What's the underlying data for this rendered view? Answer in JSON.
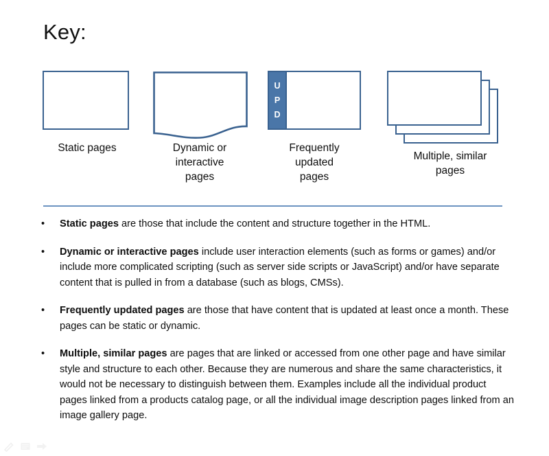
{
  "slide": {
    "title": "Key:",
    "background_color": "#ffffff",
    "accent_color": "#39618f",
    "divider_color": "#6b93c0",
    "upd_tab_color": "#4a76a8"
  },
  "key": {
    "items": [
      {
        "id": "static",
        "shape": "rectangle",
        "caption": "Static pages"
      },
      {
        "id": "dynamic",
        "shape": "wavy-bottom-document",
        "caption": "Dynamic or\ninteractive\npages",
        "caption_lines": [
          "Dynamic or",
          "interactive",
          "pages"
        ]
      },
      {
        "id": "updated",
        "shape": "rectangle-with-upd-tab",
        "caption": "Frequently\nupdated\npages",
        "caption_lines": [
          "Frequently",
          "updated",
          "pages"
        ],
        "tab_letters": [
          "U",
          "P",
          "D"
        ]
      },
      {
        "id": "multiple",
        "shape": "stacked-rectangles",
        "caption": "Multiple, similar\npages",
        "caption_lines": [
          "Multiple, similar",
          "pages"
        ],
        "stack_count": 3
      }
    ]
  },
  "body": {
    "bullet_glyph": "•",
    "bullets": [
      {
        "lead": "Static pages",
        "rest": " are those that include the content and structure together in the HTML."
      },
      {
        "lead": "Dynamic or interactive pages",
        "rest": " include user interaction elements (such as forms or games) and/or include more complicated scripting (such as server side scripts or JavaScript) and/or have separate content that is pulled in from a database (such as blogs, CMSs)."
      },
      {
        "lead": "Frequently updated pages",
        "rest": " are those that have content that is updated at least once a month. These pages can be static or dynamic."
      },
      {
        "lead": "Multiple, similar pages",
        "rest": " are pages that are linked or accessed from one other page and have similar style and structure to each other. Because they are numerous and share the same characteristics, it would not be necessary to distinguish between them. Examples include all the individual product pages linked from a products catalog page, or all the individual image description pages linked from an image gallery page."
      }
    ]
  },
  "bottom_toolbar": {
    "icons": [
      "pen-icon",
      "notes-icon",
      "arrow-right-icon"
    ]
  }
}
